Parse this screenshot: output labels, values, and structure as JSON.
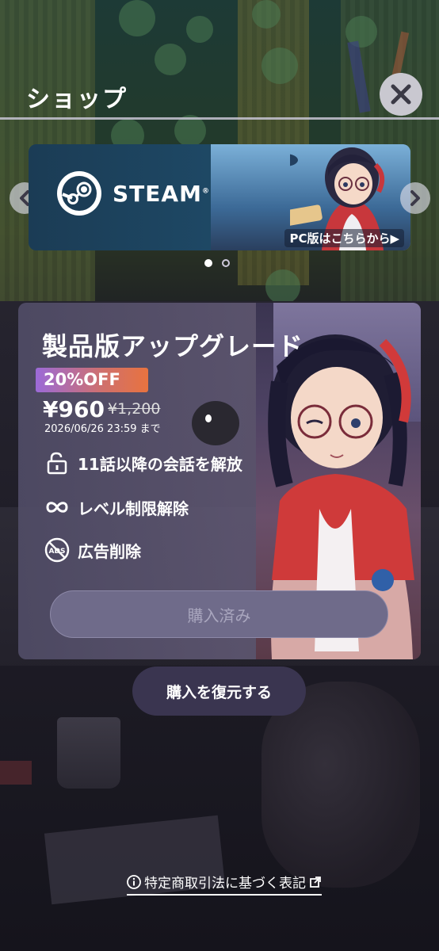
{
  "header": {
    "title": "ショップ",
    "close_icon": "close-icon"
  },
  "banner": {
    "brand": "STEAM",
    "brand_mark": "®",
    "link_label": "PC版はこちらから▶",
    "page_count": 2,
    "active_page": 1
  },
  "product": {
    "title": "製品版アップグレード",
    "discount_badge": "20%OFF",
    "price": "¥960",
    "original_price": "¥1,200",
    "deadline": "2026/06/26 23:59 まで",
    "features": [
      {
        "icon": "unlock-icon",
        "label": "11話以降の会話を解放"
      },
      {
        "icon": "infinity-icon",
        "label": "レベル制限解除"
      },
      {
        "icon": "no-ads-icon",
        "label": "広告削除"
      }
    ],
    "buy_button_label": "購入済み"
  },
  "restore_button_label": "購入を復元する",
  "legal_link_label": "特定商取引法に基づく表記",
  "colors": {
    "discount_gradient_start": "#9b6ad8",
    "discount_gradient_end": "#e8733f",
    "disabled_button": "#6f6b8a"
  }
}
